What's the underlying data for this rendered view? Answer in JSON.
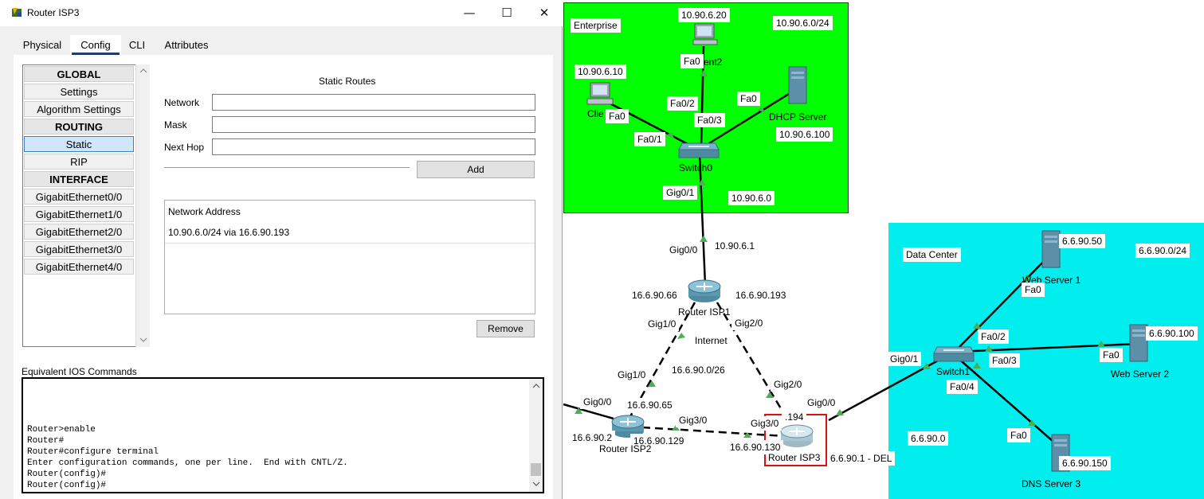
{
  "window": {
    "title": "Router ISP3",
    "minimize_glyph": "—",
    "maximize_glyph": "☐",
    "close_glyph": "✕"
  },
  "tabs": [
    "Physical",
    "Config",
    "CLI",
    "Attributes"
  ],
  "active_tab": "Config",
  "sidebar": {
    "global_header": "GLOBAL",
    "settings": "Settings",
    "algorithm_settings": "Algorithm Settings",
    "routing_header": "ROUTING",
    "static": "Static",
    "rip": "RIP",
    "interface_header": "INTERFACE",
    "interfaces": [
      "GigabitEthernet0/0",
      "GigabitEthernet1/0",
      "GigabitEthernet2/0",
      "GigabitEthernet3/0",
      "GigabitEthernet4/0"
    ]
  },
  "static_routes": {
    "heading": "Static Routes",
    "network_label": "Network",
    "mask_label": "Mask",
    "next_hop_label": "Next Hop",
    "network_value": "",
    "mask_value": "",
    "next_hop_value": "",
    "add_button": "Add",
    "table_header": "Network Address",
    "entries": [
      "10.90.6.0/24 via 16.6.90.193"
    ],
    "remove_button": "Remove"
  },
  "ios": {
    "label": "Equivalent IOS Commands",
    "lines": [
      "Router>enable",
      "Router#",
      "Router#configure terminal",
      "Enter configuration commands, one per line.  End with CNTL/Z.",
      "Router(config)#",
      "Router(config)#"
    ]
  },
  "topology": {
    "colors": {
      "enterprise": "#00ff00",
      "datacenter": "#00eeee",
      "link": "#000000",
      "port": "#4caf50",
      "highlight": "#e01010"
    },
    "enterprise": {
      "zone_label": "Enterprise",
      "subnet": "10.90.6.0/24",
      "client1_ip": "10.90.6.10",
      "client1_name": "Clie",
      "client2_ip": "10.90.6.20",
      "client2_name": "ent2",
      "dhcp_name": "DHCP Server",
      "dhcp_ip": "10.90.6.100",
      "switch_name": "Switch0",
      "network": "10.90.6.0",
      "ports": {
        "c2_fa0": "Fa0",
        "c1_fa0": "Fa0",
        "dhcp_fa0": "Fa0",
        "sw_fa0_1": "Fa0/1",
        "sw_fa0_2": "Fa0/2",
        "sw_fa0_3": "Fa0/3",
        "sw_gig0_1": "Gig0/1"
      }
    },
    "isp1": {
      "name": "Router ISP1",
      "gig0_0": "Gig0/0",
      "gig0_0_ip": "10.90.6.1",
      "left_ip": "16.6.90.66",
      "right_ip": "16.6.90.193",
      "gig1_0": "Gig1/0",
      "gig2_0": "Gig2/0"
    },
    "internet": {
      "label": "Internet",
      "subnet": "16.6.90.0/26"
    },
    "isp2": {
      "name": "Router ISP2",
      "gig1_0": "Gig1/0",
      "gig1_0_ip": "16.6.90.65",
      "gig0_0": "Gig0/0",
      "gig0_0_ip": "16.6.90.2",
      "gig3_0": "Gig3/0",
      "gig3_0_ip": "16.6.90.129"
    },
    "isp3": {
      "name": "Router ISP3",
      "gig2_0": "Gig2/0",
      "gig2_0_ip": ".194",
      "gig3_0": "Gig3/0",
      "gig3_0_ip": "16.6.90.130",
      "gig0_0": "Gig0/0",
      "gig0_0_ip": "6.6.90.1 - DEL"
    },
    "datacenter": {
      "zone_label": "Data Center",
      "subnet": "6.6.90.0/24",
      "network": "6.6.90.0",
      "switch_name": "Switch1",
      "web1_name": "Web Server 1",
      "web1_ip": "6.6.90.50",
      "web2_name": "Web Server 2",
      "web2_ip": "6.6.90.100",
      "dns_name": "DNS Server 3",
      "dns_ip": "6.6.90.150",
      "ports": {
        "sw_gig0_1": "Gig0/1",
        "sw_fa0_2": "Fa0/2",
        "sw_fa0_3": "Fa0/3",
        "sw_fa0_4": "Fa0/4",
        "web1_fa0": "Fa0",
        "web2_fa0": "Fa0",
        "dns_fa0": "Fa0"
      }
    }
  }
}
